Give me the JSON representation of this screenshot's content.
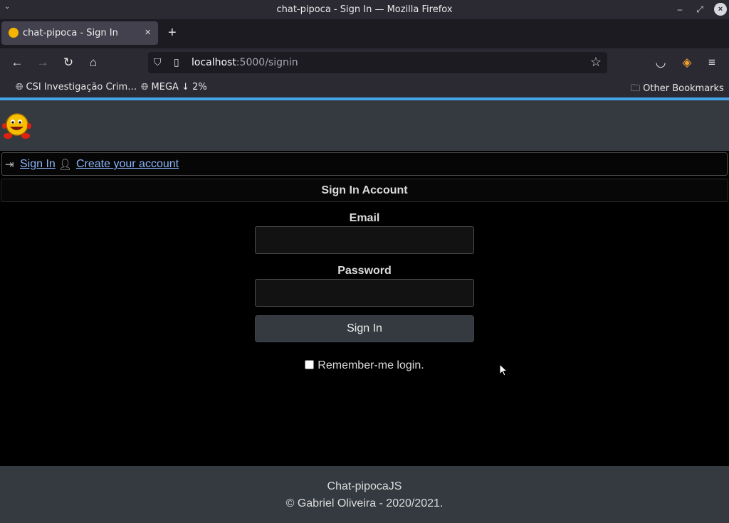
{
  "window": {
    "title": "chat-pipoca - Sign In — Mozilla Firefox"
  },
  "tab": {
    "label": "chat-pipoca - Sign In"
  },
  "urlbar": {
    "host": "localhost",
    "path": ":5000/signin"
  },
  "bookmarks": {
    "items": [
      {
        "label": "CSI Investigação Crim…"
      },
      {
        "label": "MEGA ↓ 2%"
      }
    ],
    "other": "Other Bookmarks"
  },
  "nav": {
    "signin_label": "Sign In",
    "create_label": "Create your account"
  },
  "form": {
    "header": "Sign In Account",
    "email_label": "Email",
    "email_value": "",
    "password_label": "Password",
    "password_value": "",
    "submit_label": "Sign In",
    "remember_label": "Remember-me login."
  },
  "footer": {
    "line1": "Chat-pipocaJS",
    "line2": "© Gabriel Oliveira - 2020/2021."
  },
  "colors": {
    "accent": "#46a5e8",
    "link": "#8ab4f8",
    "header_bg": "#343a40"
  }
}
